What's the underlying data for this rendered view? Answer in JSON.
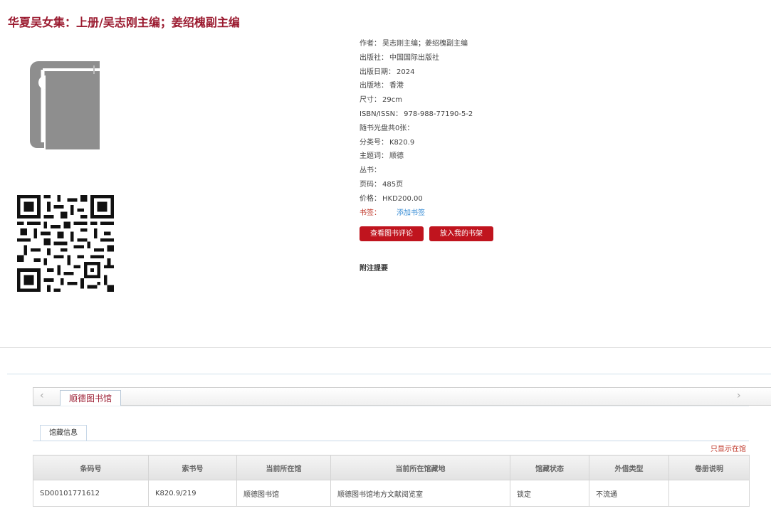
{
  "title": "华夏吴女集：上册/吴志刚主编；姜绍槐副主编",
  "meta": {
    "author_label": "作者：",
    "author": "吴志刚主编；姜绍槐副主编",
    "publisher_label": "出版社：",
    "publisher": "中国国际出版社",
    "pubdate_label": "出版日期：",
    "pubdate": "2024",
    "place_label": "出版地：",
    "place": "香港",
    "size_label": "尺寸：",
    "size": "29cm",
    "isbn_label": "ISBN/ISSN：",
    "isbn": "978-988-77190-5-2",
    "cd_label": "随书光盘共0张：",
    "class_label": "分类号：",
    "class": "K820.9",
    "subject_label": "主题词：",
    "subject": "顺德",
    "series_label": "丛书：",
    "pages_label": "页码：",
    "pages": "485页",
    "price_label": "价格：",
    "price": "HKD200.00",
    "bookmark_label": "书签：",
    "add_bookmark": "添加书签"
  },
  "buttons": {
    "review": "查看图书评论",
    "shelf": "放入我的书架"
  },
  "notes_title": "附注提要",
  "library_tab": "顺德图书馆",
  "arrows": {
    "left": "‹",
    "right": "›"
  },
  "subtab": "馆藏信息",
  "only_in_library": "只显示在馆",
  "table": {
    "headers": [
      "条码号",
      "索书号",
      "当前所在馆",
      "当前所在馆藏地",
      "馆藏状态",
      "外借类型",
      "卷册说明"
    ],
    "rows": [
      [
        "SD00101771612",
        "K820.9/219",
        "顺德图书馆",
        "顺德图书馆地方文献阅览室",
        "锁定",
        "不流通",
        ""
      ]
    ]
  },
  "colors": {
    "accent": "#9b1b30",
    "button": "#c0141e",
    "link": "#3a8ed6"
  },
  "icons": {
    "cover": "book-icon",
    "qr": "qr-code"
  }
}
